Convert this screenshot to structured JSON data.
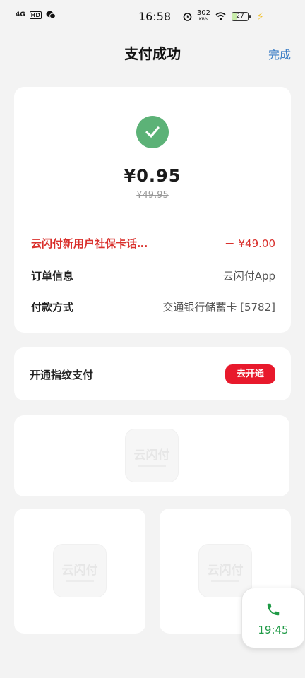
{
  "status_bar": {
    "time": "16:58",
    "signal": "4G",
    "hd": "HD",
    "net_speed_value": "302",
    "net_speed_unit": "KB/s",
    "battery": "27",
    "icons": [
      "signal-icon",
      "hd-icon",
      "wechat-icon",
      "alarm-icon",
      "wifi-icon",
      "battery-icon",
      "charging-icon"
    ]
  },
  "header": {
    "title": "支付成功",
    "done_label": "完成"
  },
  "payment": {
    "amount": "¥0.95",
    "original_amount": "¥49.95",
    "success_color": "#5cb277",
    "discount_label": "云闪付新用户社保卡话…",
    "discount_value": "－ ¥49.00",
    "order_label": "订单信息",
    "order_value": "云闪付App",
    "method_label": "付款方式",
    "method_value": "交通银行储蓄卡 [5782]"
  },
  "fingerprint": {
    "label": "开通指纹支付",
    "button_label": "去开通",
    "button_color": "#e8192c"
  },
  "placeholder_logo_text": "云闪付",
  "call_widget": {
    "duration": "19:45",
    "accent": "#1f9a46"
  }
}
